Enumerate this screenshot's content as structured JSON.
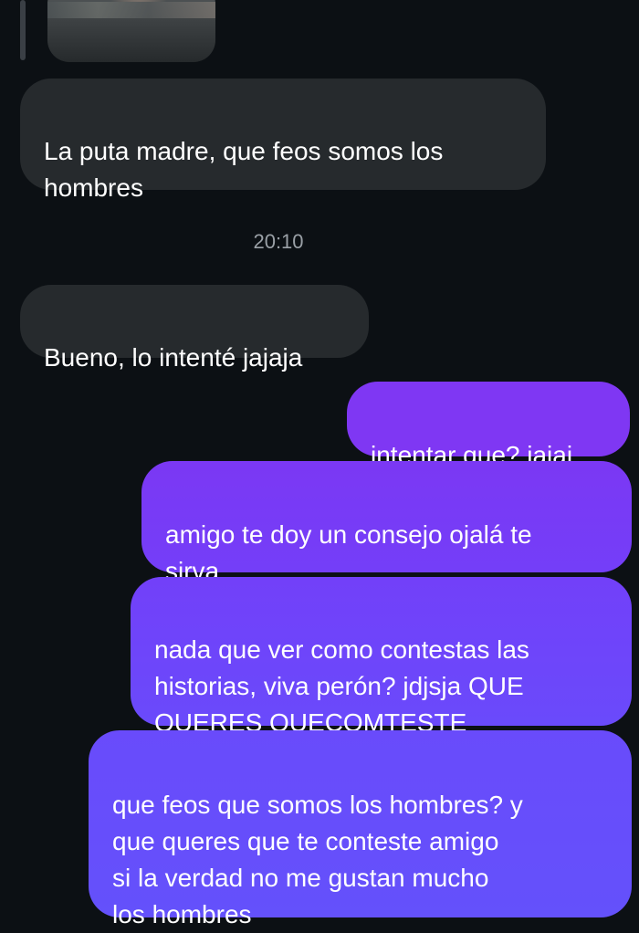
{
  "thread": {
    "shared_image_alt": "",
    "messages": [
      {
        "from": "them",
        "text": "La puta madre, que feos somos los\nhombres"
      },
      {
        "from": "them",
        "text": "Bueno, lo intenté jajaja"
      },
      {
        "from": "me",
        "text": "intentar que? jajaj"
      },
      {
        "from": "me",
        "text": "amigo te doy un consejo ojalá te\nsirva"
      },
      {
        "from": "me",
        "text": "nada que ver como contestas las\nhistorias, viva perón? jdjsja QUE\nQUERES QUECOMTESTE"
      },
      {
        "from": "me",
        "text": "que feos que somos los hombres? y\nque queres que te conteste amigo\nsi la verdad no me gustan mucho\nlos hombres"
      }
    ],
    "timestamp": "20:10"
  },
  "colors": {
    "background": "#0c1014",
    "received_bubble": "#262a2d",
    "sent_gradient": [
      "#7f37f3",
      "#6d45fb",
      "#6650fb"
    ],
    "timestamp_text": "#9aa0a6"
  }
}
